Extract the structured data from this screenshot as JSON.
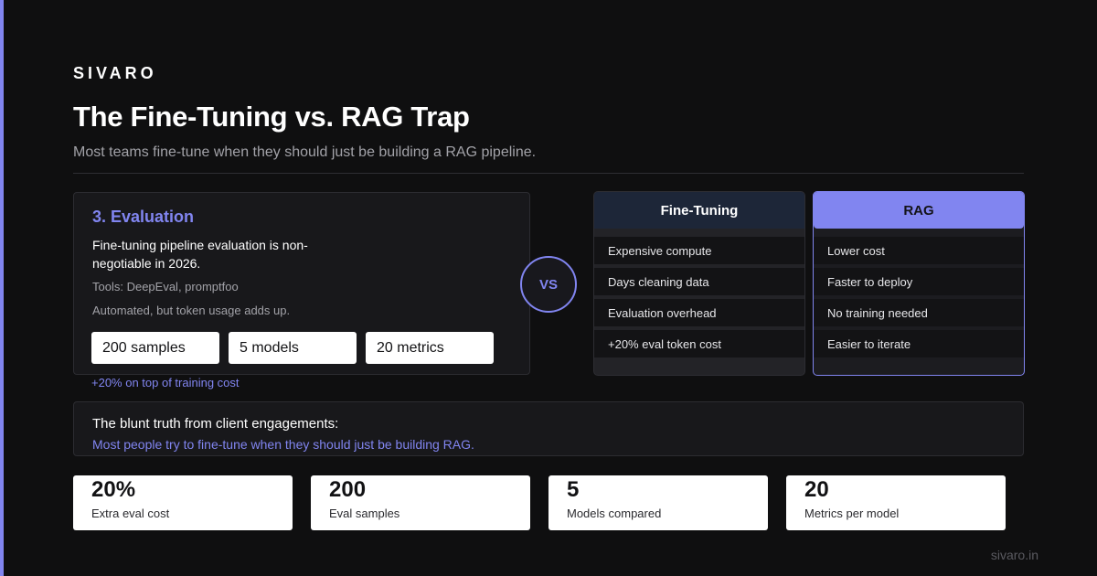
{
  "brand": "SIVARO",
  "title": "The Fine-Tuning vs. RAG Trap",
  "subtitle": "Most teams fine-tune when they should just be building a RAG pipeline.",
  "evaluation": {
    "heading": "3. Evaluation",
    "description": "Fine-tuning pipeline evaluation is non-negotiable in 2026.",
    "tools": "Tools: DeepEval, promptfoo",
    "note": "Automated, but token usage adds up.",
    "chips": [
      "200 samples",
      "5 models",
      "20 metrics"
    ],
    "footnote": "+20% on top of training cost"
  },
  "vs_label": "VS",
  "comparison": {
    "fine_tuning": {
      "title": "Fine-Tuning",
      "items": [
        "Expensive compute",
        "Days cleaning data",
        "Evaluation overhead",
        "+20% eval token cost"
      ]
    },
    "rag": {
      "title": "RAG",
      "items": [
        "Lower cost",
        "Faster to deploy",
        "No training needed",
        "Easier to iterate"
      ]
    }
  },
  "truth": {
    "lead": "The blunt truth from client engagements:",
    "sub": "Most people try to fine-tune when they should just be building RAG."
  },
  "stats": [
    {
      "value": "20%",
      "label": "Extra eval cost"
    },
    {
      "value": "200",
      "label": "Eval samples"
    },
    {
      "value": "5",
      "label": "Models compared"
    },
    {
      "value": "20",
      "label": "Metrics per model"
    }
  ],
  "footer_url": "sivaro.in",
  "colors": {
    "accent": "#8185f0",
    "background": "#0f0f10",
    "card": "#18181b",
    "fine_tuning_header": "#1d2638"
  }
}
